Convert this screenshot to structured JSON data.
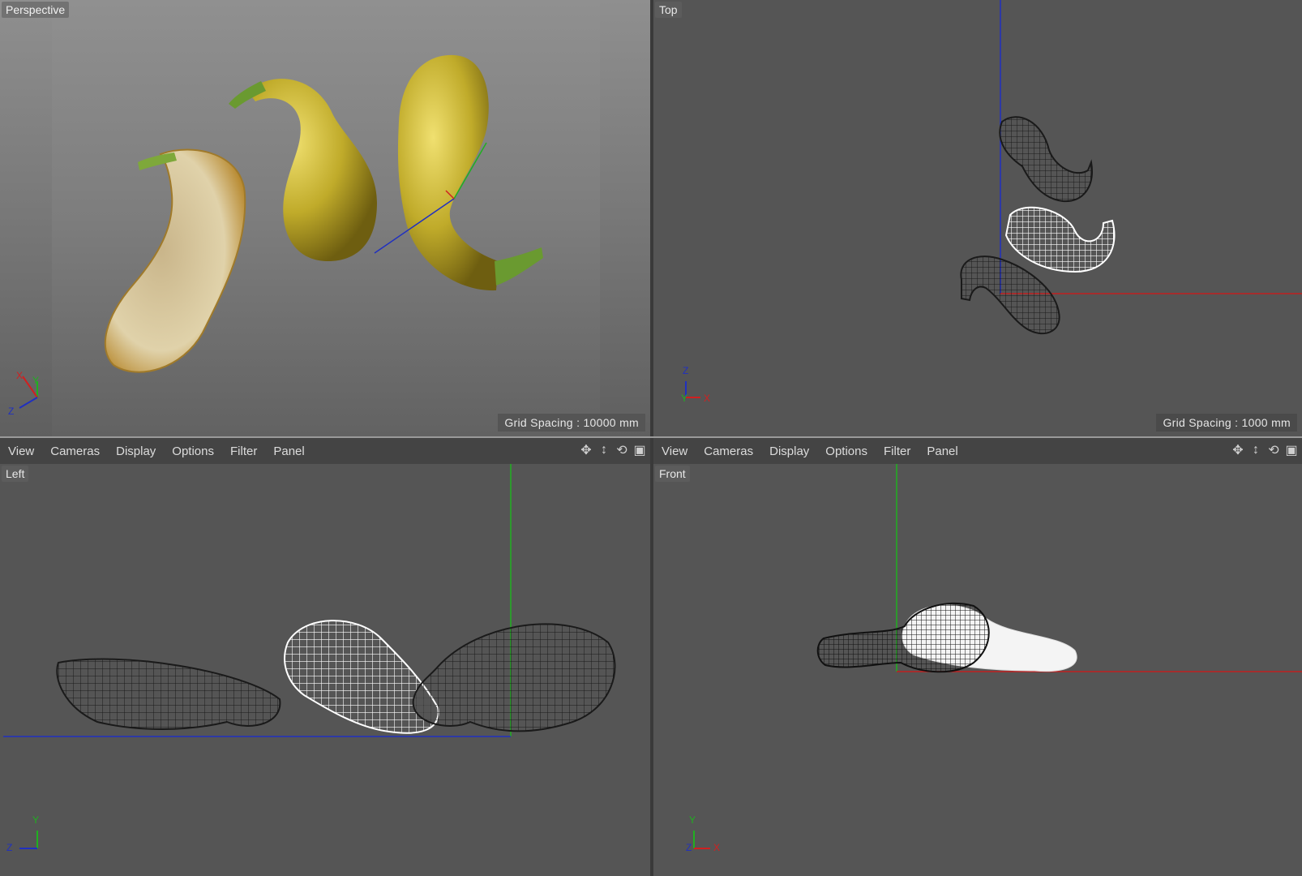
{
  "viewports": {
    "perspective": {
      "label": "Perspective",
      "grid_spacing": "Grid Spacing : 10000 mm"
    },
    "top": {
      "label": "Top",
      "grid_spacing": "Grid Spacing : 1000 mm"
    },
    "left": {
      "label": "Left"
    },
    "front": {
      "label": "Front"
    }
  },
  "menubar": {
    "items": [
      "View",
      "Cameras",
      "Display",
      "Options",
      "Filter",
      "Panel"
    ]
  },
  "axis_labels": {
    "x": "X",
    "y": "Y",
    "z": "Z"
  },
  "icons": [
    "move-icon",
    "dolly-icon",
    "rotate-icon",
    "layout-icon"
  ],
  "colors": {
    "axis_x": "#d02020",
    "axis_y": "#20b020",
    "axis_z": "#2030c0",
    "gourd_yellow": "#c8b434",
    "stem_green": "#6a9a30",
    "flesh": "#d8c8a0"
  }
}
